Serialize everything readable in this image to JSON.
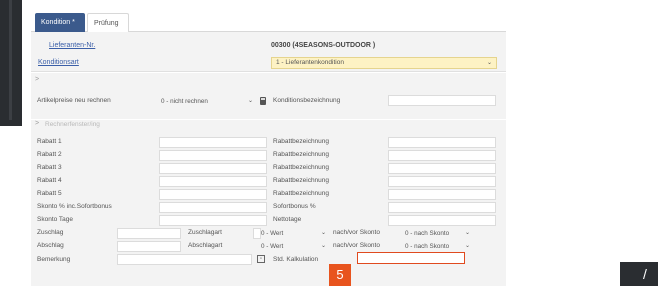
{
  "tabs": [
    {
      "label": "Kondition *"
    },
    {
      "label": "Prüfung"
    }
  ],
  "header": {
    "supplier_link": "Lieferanten-Nr.",
    "supplier_value": "00300 (4SEASONS-OUTDOOR )",
    "condition_type_link": "Konditionsart",
    "condition_type_value": "1 - Lieferantenkondition"
  },
  "section1": {
    "toggle": ">",
    "recalc_label": "Artikelpreise neu rechnen",
    "recalc_value": "0 - nicht rechnen",
    "condition_label": "Konditionsbezeichnung",
    "condition_value": ""
  },
  "section2": {
    "toggle": ">",
    "title": "Rechnerfenster/ing"
  },
  "rows": [
    {
      "label": "Rabatt 1",
      "desc_label": "Rabattbezeichnung"
    },
    {
      "label": "Rabatt 2",
      "desc_label": "Rabattbezeichnung"
    },
    {
      "label": "Rabatt 3",
      "desc_label": "Rabattbezeichnung"
    },
    {
      "label": "Rabatt 4",
      "desc_label": "Rabattbezeichnung"
    },
    {
      "label": "Rabatt 5",
      "desc_label": "Rabattbezeichnung"
    },
    {
      "label": "Skonto % inc.Sofortbonus",
      "desc_label": "Sofortbonus %"
    },
    {
      "label": "Skonto Tage",
      "desc_label": "Nettotage"
    }
  ],
  "surcharge": {
    "label": "Zuschlag",
    "type_label": "Zuschlagart",
    "type_value": "0 - Wert",
    "skonto_label": "nach/vor Skonto",
    "skonto_value": "0 - nach Skonto"
  },
  "deduction": {
    "label": "Abschlag",
    "type_label": "Abschlagart",
    "type_value": "0 - Wert",
    "skonto_label": "nach/vor Skonto",
    "skonto_value": "0 - nach Skonto"
  },
  "remark": {
    "label": "Bemerkung",
    "calc_label": "Std. Kalkulation"
  },
  "step_badge": "5",
  "colors": {
    "tab_active": "#3b5a8c",
    "highlight": "#e04a1f",
    "badge": "#e8541e",
    "select_yellow": "#fdf2c4",
    "link": "#3b5fa8"
  }
}
